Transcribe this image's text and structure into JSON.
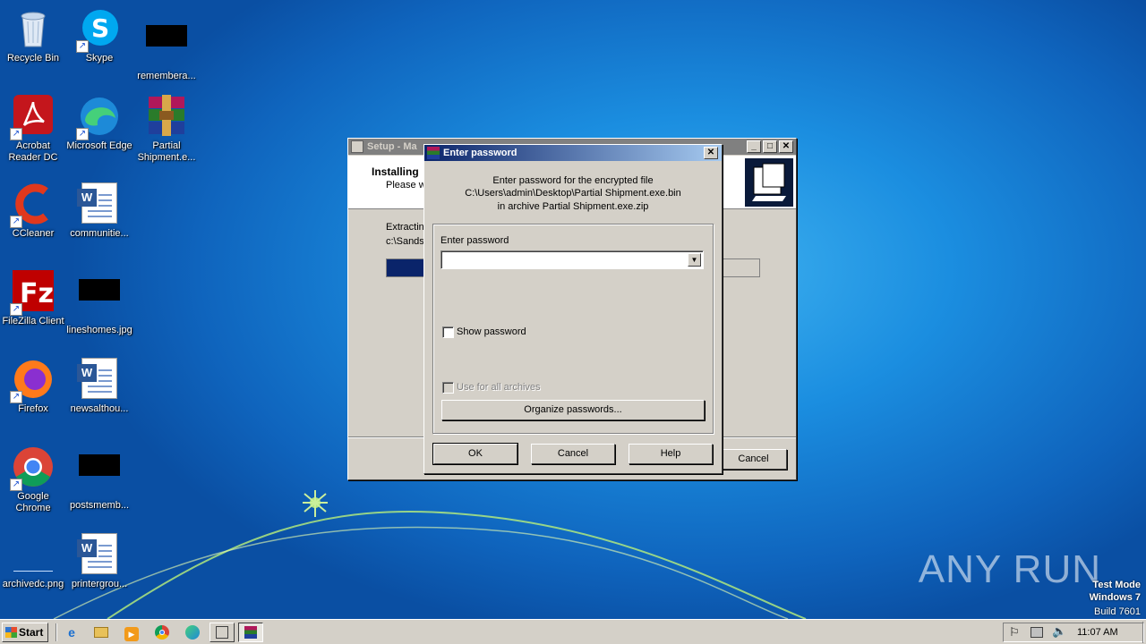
{
  "desktop": {
    "icons": [
      {
        "label": "Recycle Bin"
      },
      {
        "label": "Skype"
      },
      {
        "label": "remembera..."
      },
      {
        "label": "Acrobat Reader DC"
      },
      {
        "label": "Microsoft Edge"
      },
      {
        "label": "Partial Shipment.e..."
      },
      {
        "label": "CCleaner"
      },
      {
        "label": "communitie..."
      },
      {
        "label": "FileZilla Client"
      },
      {
        "label": "lineshomes.jpg"
      },
      {
        "label": "Firefox"
      },
      {
        "label": "newsalthou..."
      },
      {
        "label": "Google Chrome"
      },
      {
        "label": "postsmemb..."
      },
      {
        "label": "archivedc.png"
      },
      {
        "label": "printergrou..."
      }
    ]
  },
  "setup_window": {
    "title": "Setup - Ma",
    "heading": "Installing",
    "subheading": "Please w",
    "extracting_label": "Extractin",
    "extracting_path": "c:\\Sands",
    "cancel_label": "Cancel"
  },
  "password_dialog": {
    "title": "Enter password",
    "message_line1": "Enter password for the encrypted file",
    "message_line2": "C:\\Users\\admin\\Desktop\\Partial Shipment.exe.bin",
    "message_line3": "in archive Partial Shipment.exe.zip",
    "password_label": "Enter password",
    "password_value": "",
    "show_password_label": "Show password",
    "use_for_all_label": "Use for all archives",
    "organize_label": "Organize passwords...",
    "ok_label": "OK",
    "cancel_label": "Cancel",
    "help_label": "Help"
  },
  "taskbar": {
    "start_label": "Start",
    "clock": "11:07 AM"
  },
  "watermark": {
    "brand": "ANY RUN",
    "line1": "Test Mode",
    "line2": "Windows 7",
    "line3": "Build 7601"
  }
}
